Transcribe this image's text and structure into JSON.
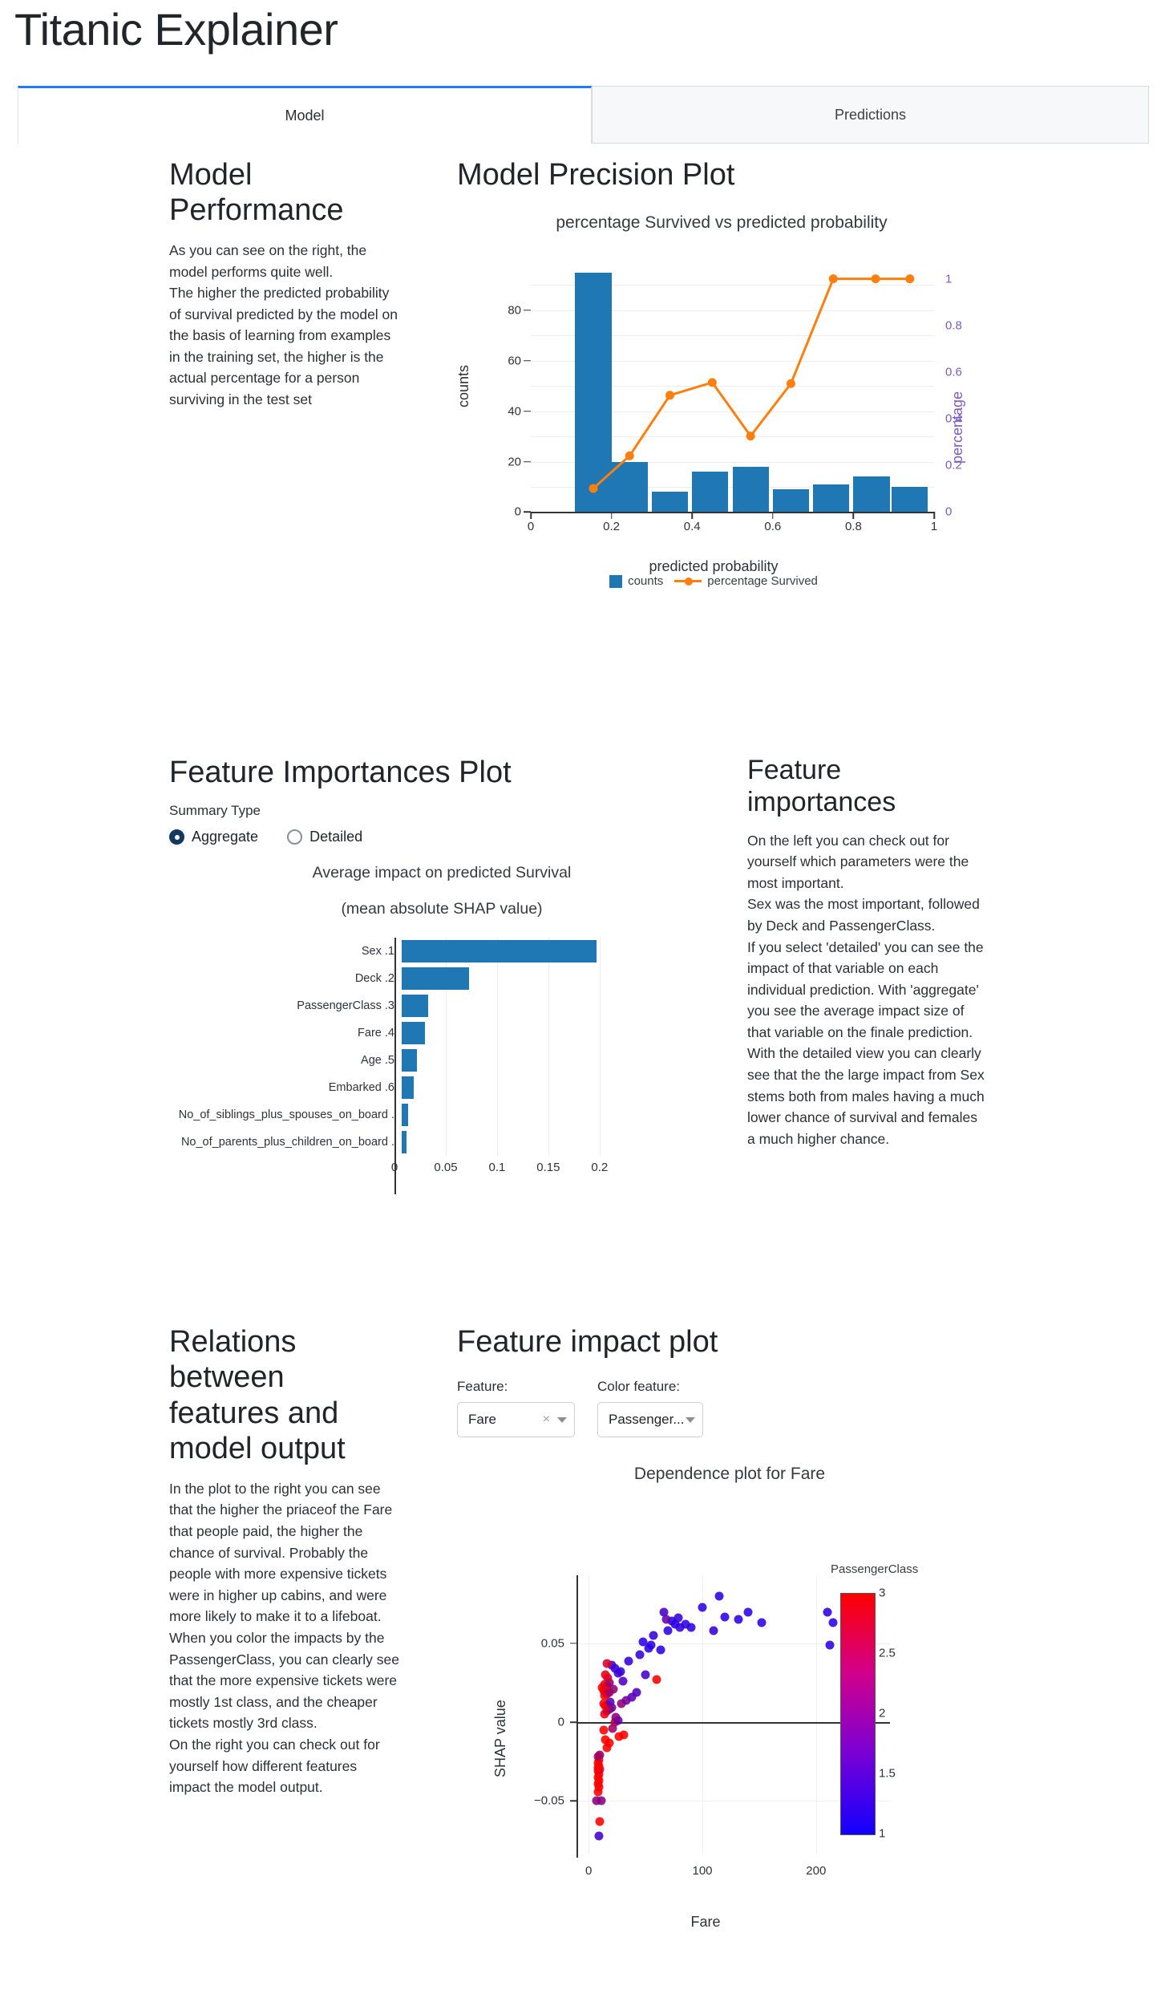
{
  "app": {
    "title": "Titanic Explainer"
  },
  "tabs": [
    {
      "label": "Model",
      "active": true
    },
    {
      "label": "Predictions",
      "active": false
    }
  ],
  "model_performance": {
    "heading": "Model Performance",
    "body": "As you can see on the right, the model performs quite well.\nThe higher the predicted probability of survival predicted by the model on the basis of learning from examples in the training set, the higher is the actual percentage for a person surviving in the test set"
  },
  "precision_section": {
    "heading": "Model Precision Plot"
  },
  "feature_importances_section": {
    "heading": "Feature Importances Plot",
    "summary_type_label": "Summary Type",
    "options": [
      {
        "label": "Aggregate",
        "selected": true
      },
      {
        "label": "Detailed",
        "selected": false
      }
    ]
  },
  "feature_importances_text": {
    "heading": "Feature importances",
    "body": "On the left you can check out for yourself which parameters were the most important.\nSex was the most important, followed by Deck and PassengerClass.\nIf you select 'detailed' you can see the impact of that variable on each individual prediction. With 'aggregate' you see the average impact size of that variable on the finale prediction. With the detailed view you can clearly see that the the large impact from Sex stems both from males having a much lower chance of survival and females a much higher chance."
  },
  "relations_text": {
    "heading": "Relations between features and model output",
    "body": "In the plot to the right you can see that the higher the priaceof the Fare that people paid, the higher the chance of survival. Probably the people with more expensive tickets were in higher up cabins, and were more likely to make it to a lifeboat.\nWhen you color the impacts by the PassengerClass, you can clearly see that the more expensive tickets were mostly 1st class, and the cheaper tickets mostly 3rd class.\nOn the right you can check out for yourself how different features impact the model output."
  },
  "feature_impact_section": {
    "heading": "Feature impact plot",
    "feature_label": "Feature:",
    "feature_value": "Fare",
    "clear_icon": "×",
    "color_feature_label": "Color feature:",
    "color_feature_value": "Passenger..."
  },
  "colors": {
    "bar_blue": "#1f77b4",
    "line_orange": "#ff7f0e",
    "percentage_purple": "#7c5bbf",
    "tab_active_border": "#1f7bf5"
  },
  "chart_data": [
    {
      "id": "precision_plot",
      "type": "bar",
      "title": "percentage Survived vs predicted probability",
      "xlabel": "predicted probability",
      "ylabel": "counts",
      "y2label": "percentage",
      "xlim": [
        0,
        1
      ],
      "ylim": [
        0,
        96
      ],
      "y2lim": [
        0,
        1.04
      ],
      "xticks": [
        "0",
        "0.2",
        "0.4",
        "0.6",
        "0.8",
        "1"
      ],
      "xtick_values": [
        0,
        0.2,
        0.4,
        0.6,
        0.8,
        1
      ],
      "yticks": [
        "0",
        "20",
        "40",
        "60",
        "80"
      ],
      "ytick_values": [
        0,
        20,
        40,
        60,
        80
      ],
      "y2ticks": [
        "0",
        "0.2",
        "0.4",
        "0.6",
        "0.8",
        "1"
      ],
      "y2tick_values": [
        0,
        0.2,
        0.4,
        0.6,
        0.8,
        1
      ],
      "grid": true,
      "legend": [
        "counts",
        "percentage Survived"
      ],
      "bars": {
        "name": "counts",
        "bin_centers": [
          0.155,
          0.245,
          0.345,
          0.445,
          0.545,
          0.645,
          0.745,
          0.845,
          0.94
        ],
        "bin_width": 0.09,
        "values": [
          95,
          20,
          8,
          16,
          18,
          9,
          11,
          14,
          10
        ]
      },
      "line": {
        "name": "percentage Survived",
        "x": [
          0.155,
          0.245,
          0.345,
          0.45,
          0.545,
          0.645,
          0.75,
          0.855,
          0.94
        ],
        "y": [
          0.1,
          0.24,
          0.5,
          0.555,
          0.325,
          0.55,
          1.0,
          1.0,
          1.0
        ]
      }
    },
    {
      "id": "feature_importances",
      "type": "bar",
      "orientation": "horizontal",
      "title": "Average impact on predicted Survival\n(mean absolute SHAP value)",
      "xlabel": "",
      "ylabel": "",
      "xlim": [
        0,
        0.215
      ],
      "xticks": [
        "0",
        "0.05",
        "0.1",
        "0.15",
        "0.2"
      ],
      "xtick_values": [
        0,
        0.05,
        0.1,
        0.15,
        0.2
      ],
      "categories": [
        "1. Sex",
        "2. Deck",
        "3. PassengerClass",
        "4. Fare",
        "5. Age",
        "6. Embarked",
        ". No_of_siblings_plus_spouses_on_board",
        ". No_of_parents_plus_children_on_board"
      ],
      "values": [
        0.19,
        0.066,
        0.026,
        0.023,
        0.015,
        0.012,
        0.006,
        0.005
      ]
    },
    {
      "id": "dependence_plot",
      "type": "scatter",
      "title": "Dependence plot for Fare",
      "xlabel": "Fare",
      "ylabel": "SHAP value",
      "xlim": [
        -10,
        265
      ],
      "ylim": [
        -0.075,
        0.093
      ],
      "xticks": [
        "0",
        "100",
        "200"
      ],
      "xtick_values": [
        0,
        100,
        200
      ],
      "yticks": [
        "0.05",
        "0",
        "−0.05"
      ],
      "ytick_values": [
        0.05,
        0,
        -0.05
      ],
      "colorbar": {
        "label": "PassengerClass",
        "ticks": [
          "3",
          "2.5",
          "2",
          "1.5",
          "1"
        ],
        "tick_values": [
          3,
          2.5,
          2,
          1.5,
          1
        ],
        "cmin": 1,
        "cmax": 3,
        "low_color": "#1400ff",
        "high_color": "#ff0000"
      },
      "points": [
        [
          7,
          -0.05,
          2.0
        ],
        [
          11,
          -0.05,
          2.0
        ],
        [
          10,
          -0.063,
          3.0
        ],
        [
          9,
          -0.072,
          1.4
        ],
        [
          8,
          -0.044,
          3.0
        ],
        [
          9,
          -0.041,
          3.0
        ],
        [
          8,
          -0.039,
          3.0
        ],
        [
          9,
          -0.037,
          3.0
        ],
        [
          8,
          -0.035,
          3.0
        ],
        [
          9,
          -0.033,
          3.0
        ],
        [
          8,
          -0.031,
          3.0
        ],
        [
          10,
          -0.03,
          2.6
        ],
        [
          8,
          -0.029,
          3.0
        ],
        [
          9,
          -0.028,
          3.0
        ],
        [
          8,
          -0.026,
          3.0
        ],
        [
          9,
          -0.024,
          3.0
        ],
        [
          8,
          -0.022,
          2.3
        ],
        [
          10,
          -0.021,
          2.2
        ],
        [
          16,
          -0.016,
          3.0
        ],
        [
          18,
          -0.013,
          3.0
        ],
        [
          15,
          -0.011,
          3.0
        ],
        [
          27,
          -0.009,
          3.0
        ],
        [
          31,
          -0.008,
          3.0
        ],
        [
          13,
          -0.005,
          3.0
        ],
        [
          21,
          -0.004,
          2.2
        ],
        [
          23,
          0.0,
          2.4
        ],
        [
          26,
          0.001,
          1.6
        ],
        [
          24,
          0.003,
          2.0
        ],
        [
          14,
          0.005,
          2.9
        ],
        [
          16,
          0.007,
          2.6
        ],
        [
          18,
          0.008,
          2.3
        ],
        [
          20,
          0.009,
          1.8
        ],
        [
          15,
          0.01,
          3.0
        ],
        [
          17,
          0.011,
          2.5
        ],
        [
          13,
          0.012,
          3.0
        ],
        [
          19,
          0.013,
          1.6
        ],
        [
          29,
          0.012,
          2.1
        ],
        [
          33,
          0.014,
          1.8
        ],
        [
          38,
          0.016,
          1.6
        ],
        [
          14,
          0.017,
          3.0
        ],
        [
          16,
          0.018,
          2.8
        ],
        [
          18,
          0.019,
          2.1
        ],
        [
          13,
          0.02,
          3.0
        ],
        [
          15,
          0.021,
          2.2
        ],
        [
          12,
          0.022,
          3.0
        ],
        [
          22,
          0.021,
          2.1
        ],
        [
          42,
          0.019,
          1.5
        ],
        [
          16,
          0.023,
          2.7
        ],
        [
          14,
          0.024,
          2.9
        ],
        [
          18,
          0.025,
          2.0
        ],
        [
          60,
          0.027,
          3.0
        ],
        [
          30,
          0.026,
          1.5
        ],
        [
          17,
          0.028,
          2.6
        ],
        [
          15,
          0.03,
          2.8
        ],
        [
          26,
          0.031,
          1.4
        ],
        [
          28,
          0.032,
          1.3
        ],
        [
          50,
          0.03,
          1.4
        ],
        [
          23,
          0.034,
          1.3
        ],
        [
          20,
          0.036,
          1.4
        ],
        [
          16,
          0.037,
          2.7
        ],
        [
          35,
          0.039,
          1.3
        ],
        [
          45,
          0.043,
          1.3
        ],
        [
          55,
          0.049,
          1.2
        ],
        [
          48,
          0.051,
          1.2
        ],
        [
          57,
          0.055,
          1.3
        ],
        [
          70,
          0.058,
          1.2
        ],
        [
          80,
          0.06,
          1.3
        ],
        [
          76,
          0.062,
          1.2
        ],
        [
          85,
          0.062,
          1.2
        ],
        [
          73,
          0.064,
          1.2
        ],
        [
          79,
          0.066,
          1.3
        ],
        [
          68,
          0.065,
          1.7
        ],
        [
          66,
          0.07,
          1.4
        ],
        [
          90,
          0.06,
          1.2
        ],
        [
          110,
          0.058,
          1.3
        ],
        [
          120,
          0.067,
          1.2
        ],
        [
          132,
          0.065,
          1.2
        ],
        [
          100,
          0.073,
          1.2
        ],
        [
          115,
          0.08,
          1.2
        ],
        [
          140,
          0.07,
          1.2
        ],
        [
          152,
          0.063,
          1.2
        ],
        [
          210,
          0.07,
          1.2
        ],
        [
          215,
          0.063,
          1.2
        ],
        [
          212,
          0.049,
          1.2
        ],
        [
          228,
          0.053,
          1.2
        ],
        [
          63,
          0.046,
          1.2
        ],
        [
          53,
          0.047,
          1.2
        ]
      ]
    }
  ]
}
